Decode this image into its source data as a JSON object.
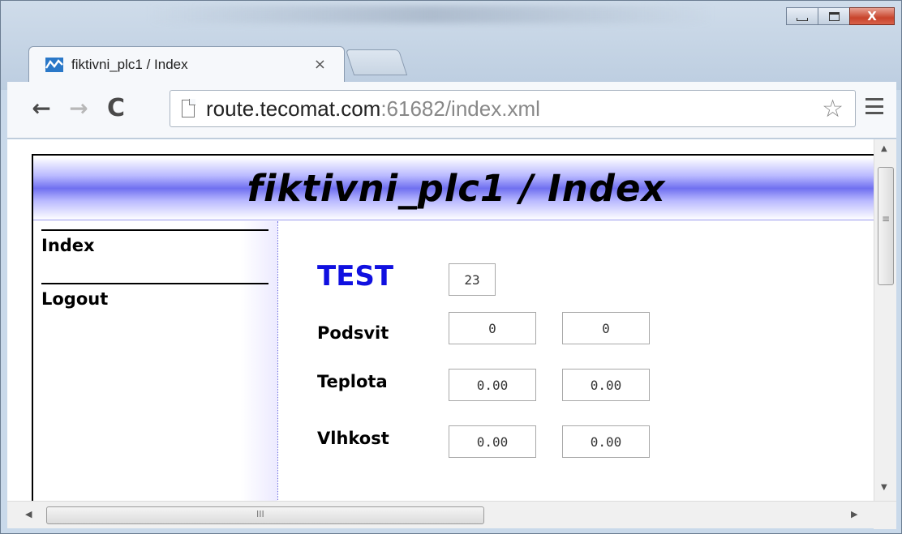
{
  "browser": {
    "tab_title": "fiktivni_plc1 / Index",
    "tab_close": "×",
    "url_host": "route.tecomat.com",
    "url_rest": ":61682/index.xml"
  },
  "window_controls": {
    "close": "X"
  },
  "page": {
    "header_title": "fiktivni_plc1 / Index",
    "nav": {
      "index": "Index",
      "logout": "Logout"
    },
    "test": {
      "label": "TEST",
      "value": "23"
    },
    "rows": [
      {
        "label": "Podsvit",
        "value1": "0",
        "value2": "0"
      },
      {
        "label": "Teplota",
        "value1": "0.00",
        "value2": "0.00"
      },
      {
        "label": "Vlhkost",
        "value1": "0.00",
        "value2": "0.00"
      }
    ]
  },
  "colors": {
    "test_label": "#1010e0",
    "header_band": "#7070f0",
    "sidebar_divider": "#6a6ae0"
  },
  "icons": {
    "favicon": "tecomat-wave-icon",
    "back": "back-arrow-icon",
    "forward": "forward-arrow-icon",
    "reload": "reload-icon",
    "page": "page-icon",
    "bookmark": "star-icon",
    "menu": "hamburger-menu-icon"
  }
}
